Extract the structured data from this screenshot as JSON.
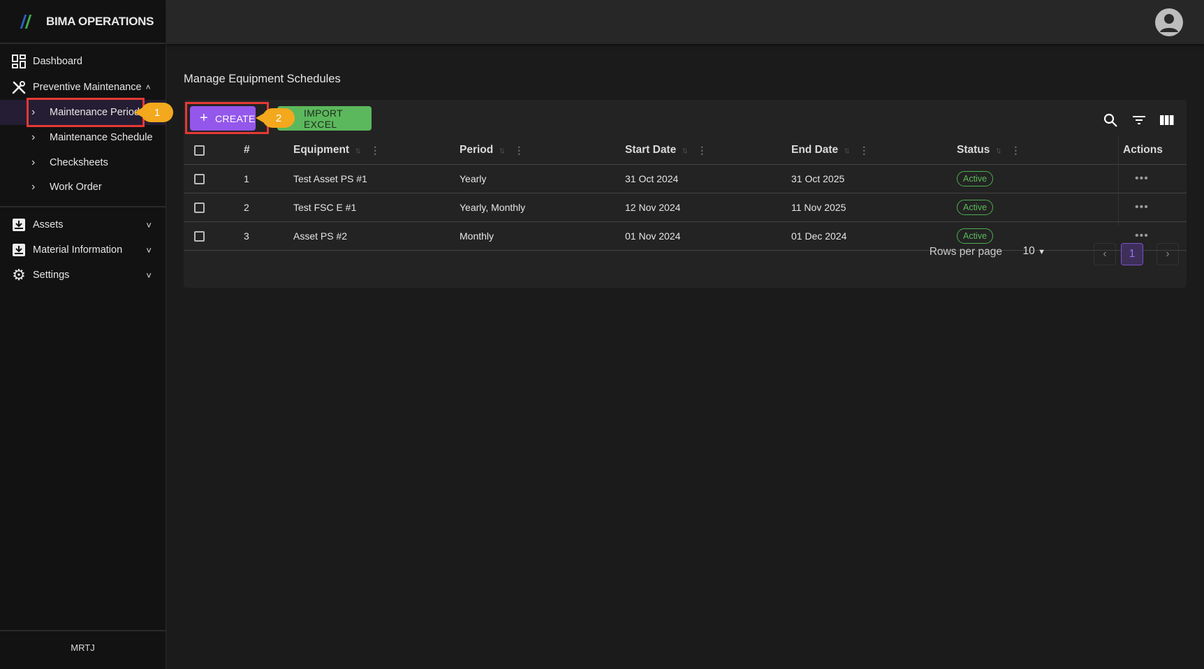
{
  "brand": {
    "title": "BIMA OPERATIONS"
  },
  "sidebar": {
    "dashboard": "Dashboard",
    "preventive": "Preventive Maintenance",
    "sub": [
      "Maintenance Period",
      "Maintenance Schedule",
      "Checksheets",
      "Work Order"
    ],
    "assets": "Assets",
    "material": "Material Information",
    "settings": "Settings",
    "footer": "MRTJ"
  },
  "annotations": [
    "1",
    "2"
  ],
  "page": {
    "title": "Manage Equipment Schedules"
  },
  "toolbar": {
    "create": "CREATE",
    "import": "IMPORT EXCEL"
  },
  "table": {
    "headers": [
      "#",
      "Equipment",
      "Period",
      "Start Date",
      "End Date",
      "Status",
      "Actions"
    ],
    "rows": [
      {
        "n": "1",
        "equipment": "Test Asset PS #1",
        "period": "Yearly",
        "start": "31 Oct 2024",
        "end": "31 Oct 2025",
        "status": "Active"
      },
      {
        "n": "2",
        "equipment": "Test FSC E #1",
        "period": "Yearly, Monthly",
        "start": "12 Nov 2024",
        "end": "11 Nov 2025",
        "status": "Active"
      },
      {
        "n": "3",
        "equipment": "Asset PS #2",
        "period": "Monthly",
        "start": "01 Nov 2024",
        "end": "01 Dec 2024",
        "status": "Active"
      }
    ]
  },
  "pagination": {
    "rows_label": "Rows per page",
    "rows_value": "10",
    "page": "1"
  },
  "colors": {
    "accent": "#9457eb",
    "success": "#5cb85c",
    "annotation": "#f4a81d",
    "highlight": "#e53935"
  }
}
